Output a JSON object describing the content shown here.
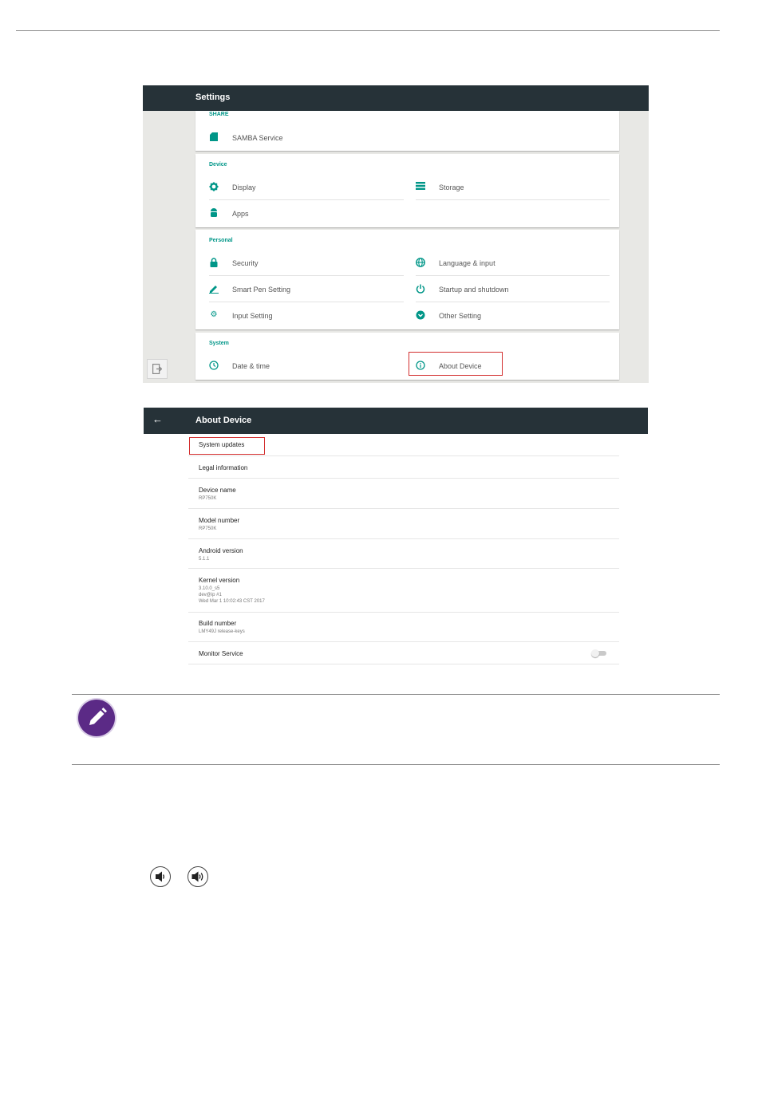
{
  "settings": {
    "title": "Settings",
    "sections": {
      "share": {
        "header": "SHARE",
        "items": [
          {
            "label": "SAMBA Service",
            "icon": "sd-card-icon"
          }
        ]
      },
      "device": {
        "header": "Device",
        "items": [
          {
            "label": "Display",
            "icon": "brightness-icon"
          },
          {
            "label": "Storage",
            "icon": "storage-list-icon"
          },
          {
            "label": "Apps",
            "icon": "android-icon"
          }
        ]
      },
      "personal": {
        "header": "Personal",
        "items": [
          {
            "label": "Security",
            "icon": "lock-icon"
          },
          {
            "label": "Language & input",
            "icon": "globe-icon"
          },
          {
            "label": "Smart Pen Setting",
            "icon": "pen-icon"
          },
          {
            "label": "Startup and shutdown",
            "icon": "power-icon"
          },
          {
            "label": "Input Setting",
            "icon": "gear-icon"
          },
          {
            "label": "Other Setting",
            "icon": "chevron-down-circle-icon"
          }
        ]
      },
      "system": {
        "header": "System",
        "items": [
          {
            "label": "Date & time",
            "icon": "clock-icon"
          },
          {
            "label": "About Device",
            "icon": "info-icon"
          }
        ]
      }
    },
    "highlight_color": "#d32f2f",
    "accent_color": "#009688",
    "appbar_color": "#263238"
  },
  "about": {
    "title": "About Device",
    "rows": [
      {
        "title": "System updates",
        "sub": []
      },
      {
        "title": "Legal information",
        "sub": []
      },
      {
        "title": "Device name",
        "sub": [
          "RP750K"
        ]
      },
      {
        "title": "Model number",
        "sub": [
          "RP750K"
        ]
      },
      {
        "title": "Android version",
        "sub": [
          "5.1.1"
        ]
      },
      {
        "title": "Kernel version",
        "sub": [
          "3.10.0_s5",
          "dev@ip #1",
          "Wed Mar 1 10:02:43 CST 2017"
        ]
      },
      {
        "title": "Build number",
        "sub": [
          "LMY49J release-keys"
        ]
      },
      {
        "title": "Monitor Service",
        "sub": []
      }
    ],
    "monitor_service_on": false
  },
  "note": {
    "icon": "pencil-note-icon",
    "color": "#5b2a86"
  },
  "volume_icons": [
    "volume-down-icon",
    "volume-up-icon"
  ]
}
